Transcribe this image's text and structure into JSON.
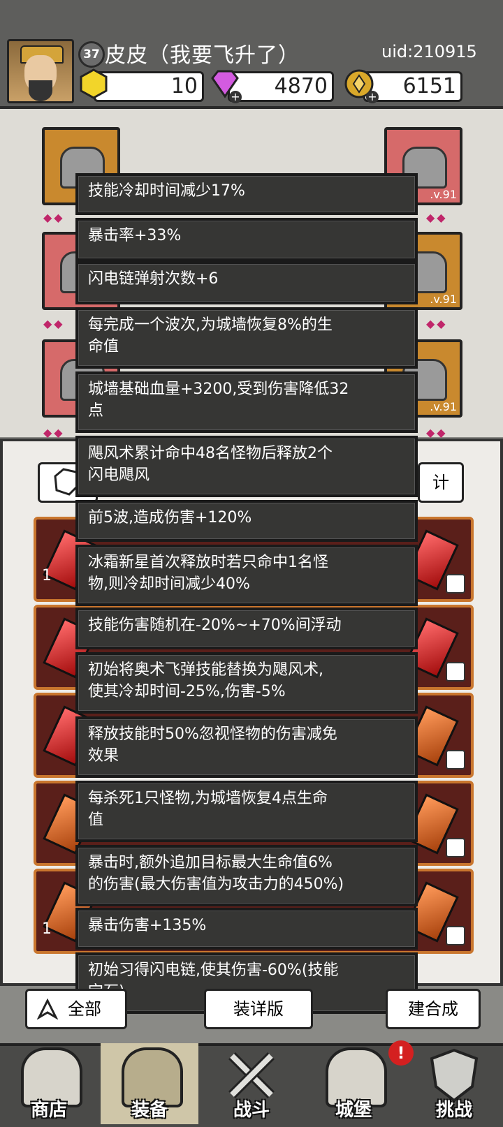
{
  "player": {
    "level": "37",
    "name": "皮皮（我要飞升了）",
    "uid": "uid:210915"
  },
  "resources": {
    "gold": "10",
    "gems": "4870",
    "coins": "6151",
    "plus_symbol": "+"
  },
  "equipment": {
    "slot_level_label": ".v.91"
  },
  "tooltips": [
    "技能冷却时间减少17%",
    "暴击率+33%",
    "闪电链弹射次数+6",
    "每完成一个波次,为城墙恢复8%的生\n命值",
    "城墙基础血量+3200,受到伤害降低32\n点",
    "飓风术累计命中48名怪物后释放2个\n闪电飓风",
    "前5波,造成伤害+120%",
    "冰霜新星首次释放时若只命中1名怪\n物,则冷却时间减少40%",
    "技能伤害随机在-20%~+70%间浮动",
    "初始将奥术飞弹技能替换为飓风术,\n使其冷却时间-25%,伤害-5%",
    "释放技能时50%忽视怪物的伤害减免\n效果",
    "每杀死1只怪物,为城墙恢复4点生命\n值",
    "暴击时,额外追加目标最大生命值6%\n的伤害(最大伤害值为攻击力的450%)",
    "暴击伤害+135%",
    "初始习得闪电链,使其伤害-60%(技能\n宝石)"
  ],
  "panel": {
    "stat_label_partial": "计",
    "row_count_label": "1",
    "filter_label_partial": "全部",
    "middle_button_partial": "装详版",
    "merge_label_partial": "建合成"
  },
  "nav": {
    "shop": "商店",
    "equipment": "装备",
    "battle": "战斗",
    "castle": "城堡",
    "challenge": "挑战",
    "alert": "!"
  },
  "colors": {
    "header_bg": "#5e5e5c",
    "tooltip_bg": "#363634",
    "red_slot": "#d66a6a",
    "active_nav": "#cfc6a8"
  }
}
